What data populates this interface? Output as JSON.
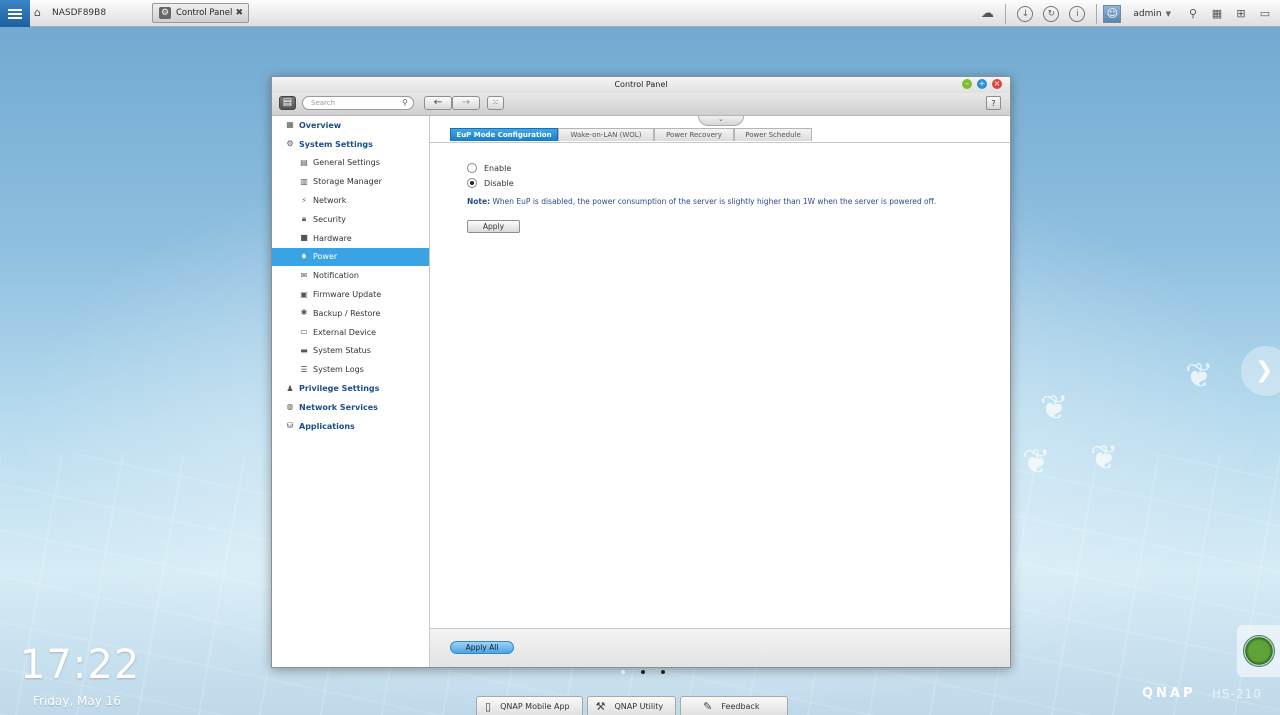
{
  "taskbar": {
    "host_name": "NASDF89B8",
    "app_tab": "Control Panel",
    "user": "admin"
  },
  "window": {
    "title": "Control Panel",
    "search_placeholder": "Search",
    "help_label": "?"
  },
  "sidebar": {
    "overview": "Overview",
    "system_settings": "System Settings",
    "sub_items": [
      "General Settings",
      "Storage Manager",
      "Network",
      "Security",
      "Hardware",
      "Power",
      "Notification",
      "Firmware Update",
      "Backup / Restore",
      "External Device",
      "System Status",
      "System Logs"
    ],
    "privilege_settings": "Privilege Settings",
    "network_services": "Network Services",
    "applications": "Applications",
    "active": "Power"
  },
  "tabs": [
    "EuP Mode Configuration",
    "Wake-on-LAN (WOL)",
    "Power Recovery",
    "Power Schedule"
  ],
  "active_tab": "EuP Mode Configuration",
  "eup": {
    "option_enable": "Enable",
    "option_disable": "Disable",
    "selected": "Disable",
    "note_label": "Note:",
    "note_text": "When EuP is disabled, the power consumption of the server is slightly higher than 1W when the server is powered off.",
    "apply_label": "Apply"
  },
  "footer": {
    "apply_all_label": "Apply All"
  },
  "desktop": {
    "time": "17:22",
    "date": "Friday, May 16",
    "brand": "QNAP",
    "model": "HS-210",
    "dock": [
      "QNAP Mobile App",
      "QNAP Utility",
      "Feedback"
    ]
  }
}
